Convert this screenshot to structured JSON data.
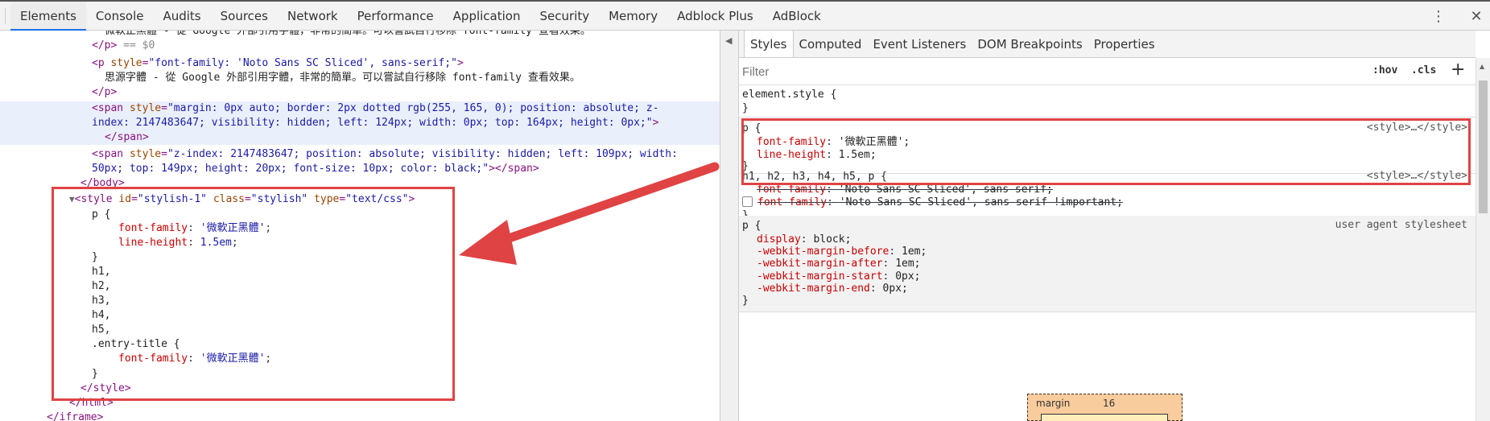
{
  "toolbar": {
    "tabs": [
      "Elements",
      "Console",
      "Audits",
      "Sources",
      "Network",
      "Performance",
      "Application",
      "Security",
      "Memory",
      "Adblock Plus",
      "AdBlock"
    ],
    "active_tab": "Elements",
    "more_icon": "kebab-icon",
    "close_icon": "close-icon"
  },
  "elements": {
    "line0": "微軟正黑體 - 從 Google 外部引用字體，非常的簡單。可以嘗試自行移除 font-family 查看效果。",
    "line1_tag": "</p>",
    "line1_eq": " == $0",
    "line2_open": "<p ",
    "line2_attr": "style",
    "line2_val": "\"font-family: 'Noto Sans SC Sliced', sans-serif;\"",
    "line2_close": ">",
    "line3": "思源字體 - 從 Google 外部引用字體，非常的簡單。可以嘗試自行移除 font-family 查看效果。",
    "line4": "</p>",
    "span1_open": "<span ",
    "span1_attr": "style",
    "span1_val_a": "\"margin: 0px auto; border: 2px dotted rgb(255, 165, 0); position: absolute; z-",
    "span1_val_b": "index: 2147483647; visibility: hidden; left: 124px; width: 0px; top: 164px; height: 0px;\"",
    "span1_close": ">",
    "span1_end": "</span>",
    "span2_open": "<span ",
    "span2_attr": "style",
    "span2_val_a": "\"z-index: 2147483647; position: absolute; visibility: hidden; left: 109px; width:",
    "span2_val_b": "50px; top: 149px; height: 20px; font-size: 10px; color: black;\"",
    "span2_close": "></span>",
    "body_end": "</body>",
    "style_open": "<style ",
    "style_id_attr": "id",
    "style_id_val": "\"stylish-1\"",
    "style_class_attr": "class",
    "style_class_val": "\"stylish\"",
    "style_type_attr": "type",
    "style_type_val": "\"text/css\"",
    "style_gt": ">",
    "css_p": "p {",
    "css_ff_prop": "font-family",
    "css_ff_val": "'微軟正黑體'",
    "css_lh_prop": "line-height",
    "css_lh_val": "1.5em",
    "css_close": "}",
    "css_h1": "h1,",
    "css_h2": "h2,",
    "css_h3": "h3,",
    "css_h4": "h4,",
    "css_h5": "h5,",
    "css_entry": ".entry-title {",
    "css_ff2_val": "'微軟正黑體'",
    "css_close2": "}",
    "style_end": "</style>",
    "html_end": "</html>",
    "iframe_end": "</iframe>"
  },
  "styles_panel": {
    "tabs": [
      "Styles",
      "Computed",
      "Event Listeners",
      "DOM Breakpoints",
      "Properties"
    ],
    "active_tab": "Styles",
    "filter_placeholder": "Filter",
    "hov": ":hov",
    "cls": ".cls",
    "add": "+",
    "element_style": "element.style {",
    "rule1": {
      "selector": "p {",
      "source": "<style>…</style>",
      "ff_prop": "font-family",
      "ff_val": "'微軟正黑體';",
      "lh_prop": "line-height",
      "lh_val": "1.5em;",
      "close": "}"
    },
    "rule2": {
      "selector": "h1, h2, h3, h4, h5, p {",
      "source": "<style>…</style>",
      "decl1_prop": "font-family",
      "decl1_val": "'Noto Sans SC Sliced', sans-serif;",
      "decl2_prop": "font-family",
      "decl2_val": "'Noto Sans SC Sliced', sans-serif !important;",
      "close": "}"
    },
    "rule3": {
      "selector": "p {",
      "source": "user agent stylesheet",
      "decls": [
        {
          "prop": "display",
          "val": "block;"
        },
        {
          "prop": "-webkit-margin-before",
          "val": "1em;"
        },
        {
          "prop": "-webkit-margin-after",
          "val": "1em;"
        },
        {
          "prop": "-webkit-margin-start",
          "val": "0px;"
        },
        {
          "prop": "-webkit-margin-end",
          "val": "0px;"
        }
      ],
      "close": "}"
    },
    "boxmodel": {
      "label": "margin",
      "value": "16"
    }
  },
  "colors": {
    "annotation_red": "#e04343",
    "active_tab_blue": "#1a73e8"
  }
}
